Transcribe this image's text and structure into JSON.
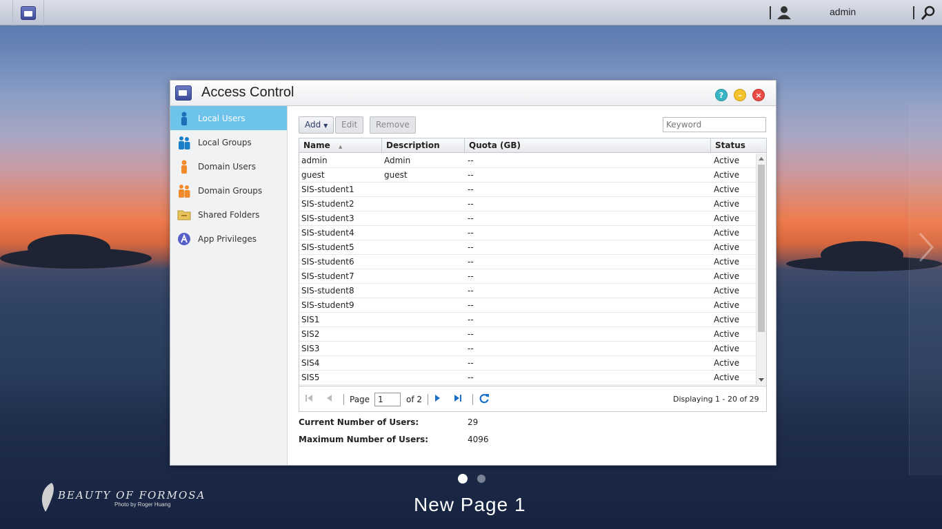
{
  "topbar": {
    "user_name": "admin"
  },
  "window": {
    "title": "Access Control",
    "help_glyph": "?",
    "minimize_glyph": "–",
    "close_glyph": "×"
  },
  "sidebar": {
    "items": [
      {
        "label": "Local Users",
        "icon": "user-icon",
        "color": "#1a7fc9"
      },
      {
        "label": "Local Groups",
        "icon": "users-group-icon",
        "color": "#1a7fc9"
      },
      {
        "label": "Domain Users",
        "icon": "domain-user-icon",
        "color": "#f28a2c"
      },
      {
        "label": "Domain Groups",
        "icon": "domain-group-icon",
        "color": "#f28a2c"
      },
      {
        "label": "Shared Folders",
        "icon": "folder-icon",
        "color": "#e8c35a"
      },
      {
        "label": "App Privileges",
        "icon": "app-privileges-icon",
        "color": "#5561c6"
      }
    ]
  },
  "toolbar": {
    "add_label": "Add",
    "edit_label": "Edit",
    "remove_label": "Remove",
    "keyword_placeholder": "Keyword"
  },
  "grid": {
    "columns": [
      "Name",
      "Description",
      "Quota (GB)",
      "Status"
    ],
    "rows": [
      [
        "admin",
        "Admin",
        "--",
        "Active"
      ],
      [
        "guest",
        "guest",
        "--",
        "Active"
      ],
      [
        "SIS-student1",
        "",
        "--",
        "Active"
      ],
      [
        "SIS-student2",
        "",
        "--",
        "Active"
      ],
      [
        "SIS-student3",
        "",
        "--",
        "Active"
      ],
      [
        "SIS-student4",
        "",
        "--",
        "Active"
      ],
      [
        "SIS-student5",
        "",
        "--",
        "Active"
      ],
      [
        "SIS-student6",
        "",
        "--",
        "Active"
      ],
      [
        "SIS-student7",
        "",
        "--",
        "Active"
      ],
      [
        "SIS-student8",
        "",
        "--",
        "Active"
      ],
      [
        "SIS-student9",
        "",
        "--",
        "Active"
      ],
      [
        "SIS1",
        "",
        "--",
        "Active"
      ],
      [
        "SIS2",
        "",
        "--",
        "Active"
      ],
      [
        "SIS3",
        "",
        "--",
        "Active"
      ],
      [
        "SIS4",
        "",
        "--",
        "Active"
      ],
      [
        "SIS5",
        "",
        "--",
        "Active"
      ]
    ]
  },
  "pager": {
    "page_label": "Page",
    "page_value": "1",
    "of_label": "of 2",
    "displaying": "Displaying 1 - 20 of 29"
  },
  "stats": {
    "current_label": "Current Number of Users:",
    "current_value": "29",
    "max_label": "Maximum Number of Users:",
    "max_value": "4096"
  },
  "desktop": {
    "page_name": "New Page 1",
    "brand": "BEAUTY OF FORMOSA",
    "credit": "Photo by Roger Huang"
  }
}
